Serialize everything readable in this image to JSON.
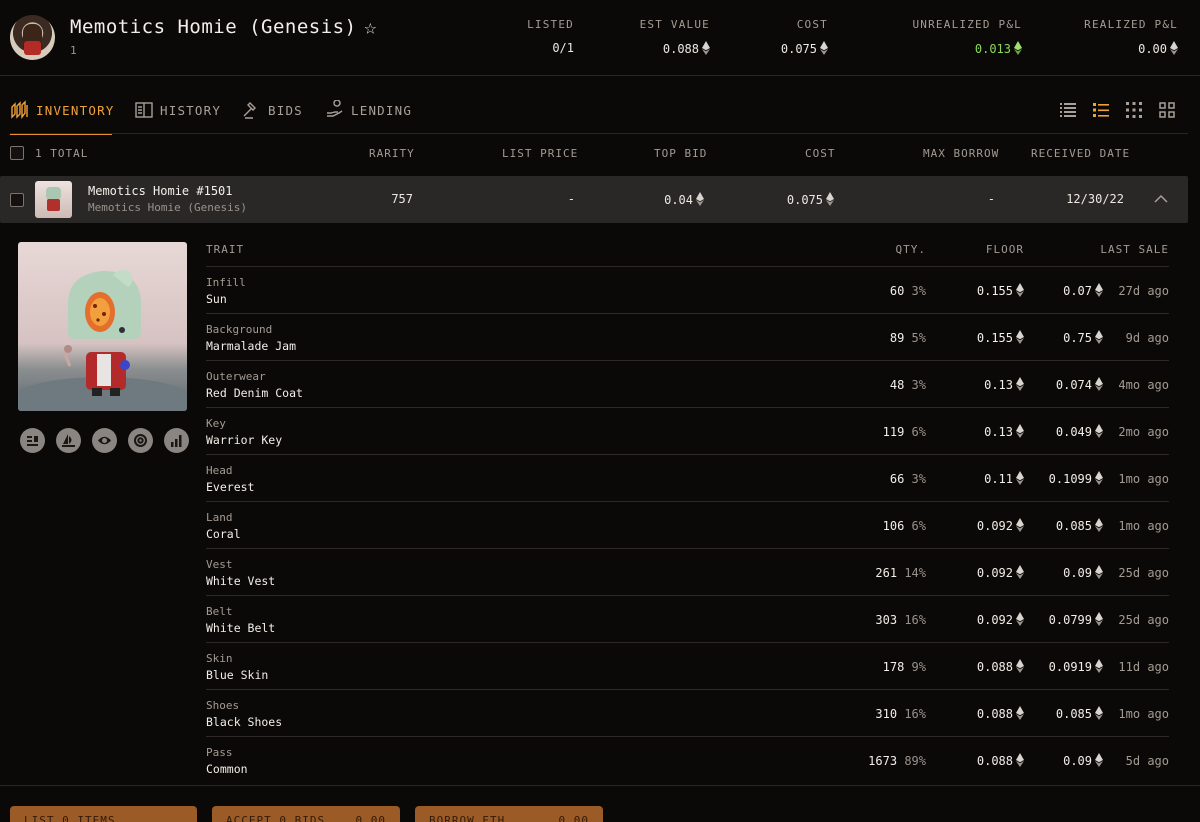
{
  "header": {
    "collection_name": "Memotics Homie (Genesis)",
    "count": "1",
    "stats": [
      {
        "label": "LISTED",
        "value": "0/1",
        "eth": false
      },
      {
        "label": "EST VALUE",
        "value": "0.088",
        "eth": true
      },
      {
        "label": "COST",
        "value": "0.075",
        "eth": true
      },
      {
        "label": "UNREALIZED P&L",
        "value": "0.013",
        "eth": true,
        "color": "#8bd85a"
      },
      {
        "label": "REALIZED P&L",
        "value": "0.00",
        "eth": true
      }
    ]
  },
  "tabs": [
    {
      "label": "INVENTORY",
      "icon": "inventory-icon",
      "active": true
    },
    {
      "label": "HISTORY",
      "icon": "history-icon",
      "active": false
    },
    {
      "label": "BIDS",
      "icon": "gavel-icon",
      "active": false
    },
    {
      "label": "LENDING",
      "icon": "lending-icon",
      "active": false
    }
  ],
  "view_icons": [
    "list-view-icon",
    "compact-list-view-icon",
    "small-grid-view-icon",
    "large-grid-view-icon"
  ],
  "table": {
    "total_label": "1 TOTAL",
    "columns": [
      "RARITY",
      "LIST PRICE",
      "TOP BID",
      "COST",
      "MAX BORROW",
      "RECEIVED DATE"
    ]
  },
  "item": {
    "name": "Memotics Homie #1501",
    "collection": "Memotics Homie (Genesis)",
    "rarity": "757",
    "list_price": "-",
    "top_bid": "0.04",
    "cost": "0.075",
    "max_borrow": "-",
    "received_date": "12/30/22"
  },
  "trait_columns": {
    "trait": "TRAIT",
    "qty": "QTY.",
    "floor": "FLOOR",
    "last_sale": "LAST SALE"
  },
  "traits": [
    {
      "type": "Infill",
      "value": "Sun",
      "qty": "60",
      "pct": "3%",
      "floor": "0.155",
      "last": "0.07",
      "ago": "27d ago"
    },
    {
      "type": "Background",
      "value": "Marmalade Jam",
      "qty": "89",
      "pct": "5%",
      "floor": "0.155",
      "last": "0.75",
      "ago": "9d ago"
    },
    {
      "type": "Outerwear",
      "value": "Red Denim Coat",
      "qty": "48",
      "pct": "3%",
      "floor": "0.13",
      "last": "0.074",
      "ago": "4mo ago"
    },
    {
      "type": "Key",
      "value": "Warrior Key",
      "qty": "119",
      "pct": "6%",
      "floor": "0.13",
      "last": "0.049",
      "ago": "2mo ago"
    },
    {
      "type": "Head",
      "value": "Everest",
      "qty": "66",
      "pct": "3%",
      "floor": "0.11",
      "last": "0.1099",
      "ago": "1mo ago"
    },
    {
      "type": "Land",
      "value": "Coral",
      "qty": "106",
      "pct": "6%",
      "floor": "0.092",
      "last": "0.085",
      "ago": "1mo ago"
    },
    {
      "type": "Vest",
      "value": "White Vest",
      "qty": "261",
      "pct": "14%",
      "floor": "0.092",
      "last": "0.09",
      "ago": "25d ago"
    },
    {
      "type": "Belt",
      "value": "White Belt",
      "qty": "303",
      "pct": "16%",
      "floor": "0.092",
      "last": "0.0799",
      "ago": "25d ago"
    },
    {
      "type": "Skin",
      "value": "Blue Skin",
      "qty": "178",
      "pct": "9%",
      "floor": "0.088",
      "last": "0.0919",
      "ago": "11d ago"
    },
    {
      "type": "Shoes",
      "value": "Black Shoes",
      "qty": "310",
      "pct": "16%",
      "floor": "0.088",
      "last": "0.085",
      "ago": "1mo ago"
    },
    {
      "type": "Pass",
      "value": "Common",
      "qty": "1673",
      "pct": "89%",
      "floor": "0.088",
      "last": "0.09",
      "ago": "5d ago"
    }
  ],
  "item_actions": [
    "etherscan-icon",
    "opensea-icon",
    "looksrare-icon",
    "x2y2-icon",
    "chart-icon"
  ],
  "footer_buttons": [
    {
      "label": "LIST 0 ITEMS",
      "amount": ""
    },
    {
      "label": "ACCEPT 0 BIDS",
      "amount": "0.00"
    },
    {
      "label": "BORROW ETH",
      "amount": "0.00"
    }
  ],
  "colors": {
    "accent": "#f0a23a",
    "positive": "#8bd85a",
    "background": "#0b0908"
  }
}
